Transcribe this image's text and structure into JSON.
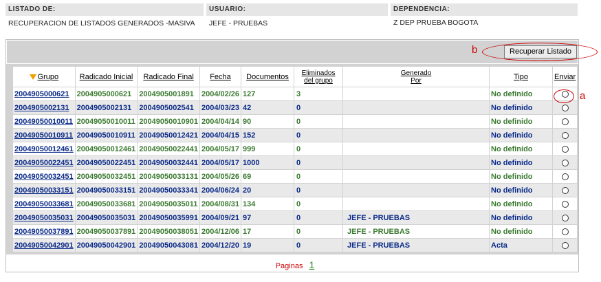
{
  "header": {
    "listado_label": "LISTADO DE:",
    "listado_value": "RECUPERACION DE LISTADOS GENERADOS -MASIVA",
    "usuario_label": "USUARIO:",
    "usuario_value": "JEFE - PRUEBAS",
    "dependencia_label": "DEPENDENCIA:",
    "dependencia_value": "Z DEP PRUEBA BOGOTA"
  },
  "toolbar": {
    "recuperar_label": "Recuperar Listado",
    "marker_b": "b",
    "marker_a": "a"
  },
  "table": {
    "columns": {
      "grupo": "Grupo",
      "radicado_inicial": "Radicado Inicial",
      "radicado_final": "Radicado Final",
      "fecha": "Fecha",
      "documentos": "Documentos",
      "eliminados_1": "Eliminados",
      "eliminados_2": "del grupo",
      "generado_1": "Generado",
      "generado_2": "Por",
      "tipo": "Tipo",
      "enviar": "Enviar"
    },
    "rows": [
      {
        "grupo": "2004905000621",
        "ini": "2004905000621",
        "fin": "2004905001891",
        "fecha": "2004/02/26",
        "docs": "127",
        "elim": "3",
        "gen": "",
        "tipo": "No definido",
        "color": "green"
      },
      {
        "grupo": "2004905002131",
        "ini": "2004905002131",
        "fin": "2004905002541",
        "fecha": "2004/03/23",
        "docs": "42",
        "elim": "0",
        "gen": "",
        "tipo": "No definido",
        "color": "blue"
      },
      {
        "grupo": "20049050010011",
        "ini": "20049050010011",
        "fin": "20049050010901",
        "fecha": "2004/04/14",
        "docs": "90",
        "elim": "0",
        "gen": "",
        "tipo": "No definido",
        "color": "green"
      },
      {
        "grupo": "20049050010911",
        "ini": "20049050010911",
        "fin": "20049050012421",
        "fecha": "2004/04/15",
        "docs": "152",
        "elim": "0",
        "gen": "",
        "tipo": "No definido",
        "color": "blue"
      },
      {
        "grupo": "20049050012461",
        "ini": "20049050012461",
        "fin": "20049050022441",
        "fecha": "2004/05/17",
        "docs": "999",
        "elim": "0",
        "gen": "",
        "tipo": "No definido",
        "color": "green"
      },
      {
        "grupo": "20049050022451",
        "ini": "20049050022451",
        "fin": "20049050032441",
        "fecha": "2004/05/17",
        "docs": "1000",
        "elim": "0",
        "gen": "",
        "tipo": "No definido",
        "color": "blue"
      },
      {
        "grupo": "20049050032451",
        "ini": "20049050032451",
        "fin": "20049050033131",
        "fecha": "2004/05/26",
        "docs": "69",
        "elim": "0",
        "gen": "",
        "tipo": "No definido",
        "color": "green"
      },
      {
        "grupo": "20049050033151",
        "ini": "20049050033151",
        "fin": "20049050033341",
        "fecha": "2004/06/24",
        "docs": "20",
        "elim": "0",
        "gen": "",
        "tipo": "No definido",
        "color": "blue"
      },
      {
        "grupo": "20049050033681",
        "ini": "20049050033681",
        "fin": "20049050035011",
        "fecha": "2004/08/31",
        "docs": "134",
        "elim": "0",
        "gen": "",
        "tipo": "No definido",
        "color": "green"
      },
      {
        "grupo": "20049050035031",
        "ini": "20049050035031",
        "fin": "20049050035991",
        "fecha": "2004/09/21",
        "docs": "97",
        "elim": "0",
        "gen": "JEFE - PRUEBAS",
        "tipo": "No definido",
        "color": "blue"
      },
      {
        "grupo": "20049050037891",
        "ini": "20049050037891",
        "fin": "20049050038051",
        "fecha": "2004/12/06",
        "docs": "17",
        "elim": "0",
        "gen": "JEFE - PRUEBAS",
        "tipo": "No definido",
        "color": "green"
      },
      {
        "grupo": "20049050042901",
        "ini": "20049050042901",
        "fin": "20049050043081",
        "fecha": "2004/12/20",
        "docs": "19",
        "elim": "0",
        "gen": "JEFE - PRUEBAS",
        "tipo": "Acta",
        "color": "blue"
      }
    ]
  },
  "pagination": {
    "label": "Paginas",
    "page": "1"
  },
  "colors": {
    "green": "#3b7a30",
    "blue": "#0a2a88",
    "annotation": "#cc0000",
    "header_bg": "#e6e6e6",
    "panel_bg": "#d2d2d2"
  }
}
